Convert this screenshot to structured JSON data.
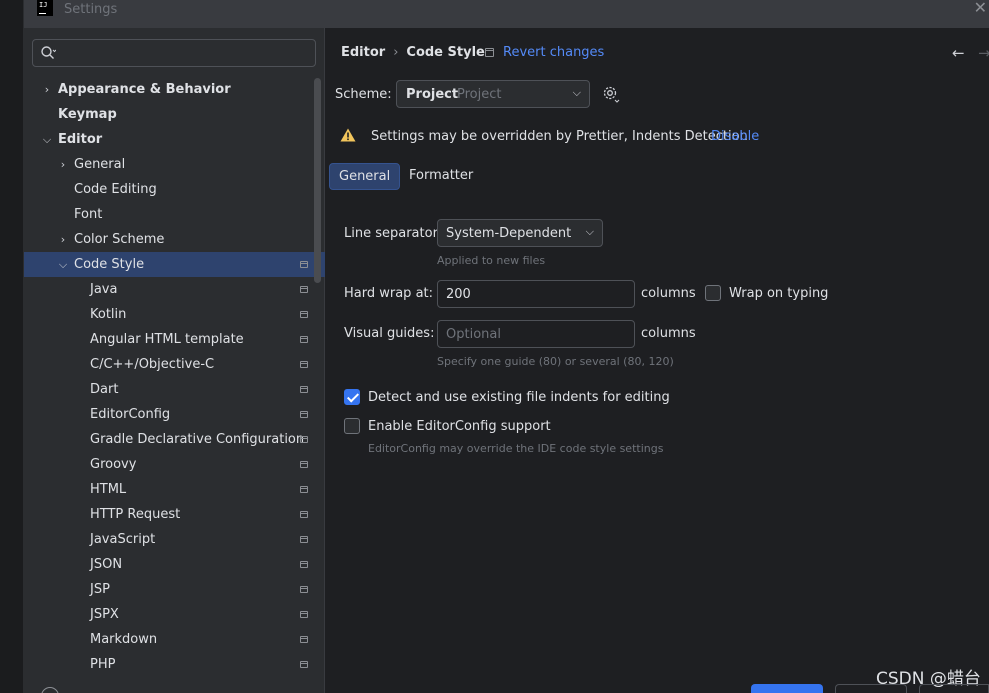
{
  "window": {
    "title": "Settings",
    "app_icon_text": "IJ"
  },
  "search": {
    "placeholder": ""
  },
  "tree": [
    {
      "label": "Appearance & Behavior",
      "bold": true,
      "chevron": "right",
      "depth": 0,
      "page_icon": false,
      "selected": false
    },
    {
      "label": "Keymap",
      "bold": true,
      "chevron": "",
      "depth": 0,
      "page_icon": false,
      "selected": false
    },
    {
      "label": "Editor",
      "bold": true,
      "chevron": "down",
      "depth": 0,
      "page_icon": false,
      "selected": false
    },
    {
      "label": "General",
      "bold": false,
      "chevron": "right",
      "depth": 1,
      "page_icon": false,
      "selected": false
    },
    {
      "label": "Code Editing",
      "bold": false,
      "chevron": "",
      "depth": 1,
      "page_icon": false,
      "selected": false
    },
    {
      "label": "Font",
      "bold": false,
      "chevron": "",
      "depth": 1,
      "page_icon": false,
      "selected": false
    },
    {
      "label": "Color Scheme",
      "bold": false,
      "chevron": "right",
      "depth": 1,
      "page_icon": false,
      "selected": false
    },
    {
      "label": "Code Style",
      "bold": false,
      "chevron": "down",
      "depth": 1,
      "page_icon": true,
      "selected": true
    },
    {
      "label": "Java",
      "bold": false,
      "chevron": "",
      "depth": 2,
      "page_icon": true,
      "selected": false
    },
    {
      "label": "Kotlin",
      "bold": false,
      "chevron": "",
      "depth": 2,
      "page_icon": true,
      "selected": false
    },
    {
      "label": "Angular HTML template",
      "bold": false,
      "chevron": "",
      "depth": 2,
      "page_icon": true,
      "selected": false
    },
    {
      "label": "C/C++/Objective-C",
      "bold": false,
      "chevron": "",
      "depth": 2,
      "page_icon": true,
      "selected": false
    },
    {
      "label": "Dart",
      "bold": false,
      "chevron": "",
      "depth": 2,
      "page_icon": true,
      "selected": false
    },
    {
      "label": "EditorConfig",
      "bold": false,
      "chevron": "",
      "depth": 2,
      "page_icon": true,
      "selected": false
    },
    {
      "label": "Gradle Declarative Configuration",
      "bold": false,
      "chevron": "",
      "depth": 2,
      "page_icon": true,
      "selected": false
    },
    {
      "label": "Groovy",
      "bold": false,
      "chevron": "",
      "depth": 2,
      "page_icon": true,
      "selected": false
    },
    {
      "label": "HTML",
      "bold": false,
      "chevron": "",
      "depth": 2,
      "page_icon": true,
      "selected": false
    },
    {
      "label": "HTTP Request",
      "bold": false,
      "chevron": "",
      "depth": 2,
      "page_icon": true,
      "selected": false
    },
    {
      "label": "JavaScript",
      "bold": false,
      "chevron": "",
      "depth": 2,
      "page_icon": true,
      "selected": false
    },
    {
      "label": "JSON",
      "bold": false,
      "chevron": "",
      "depth": 2,
      "page_icon": true,
      "selected": false
    },
    {
      "label": "JSP",
      "bold": false,
      "chevron": "",
      "depth": 2,
      "page_icon": true,
      "selected": false
    },
    {
      "label": "JSPX",
      "bold": false,
      "chevron": "",
      "depth": 2,
      "page_icon": true,
      "selected": false
    },
    {
      "label": "Markdown",
      "bold": false,
      "chevron": "",
      "depth": 2,
      "page_icon": true,
      "selected": false
    },
    {
      "label": "PHP",
      "bold": false,
      "chevron": "",
      "depth": 2,
      "page_icon": true,
      "selected": false
    }
  ],
  "header": {
    "breadcrumb_parent": "Editor",
    "breadcrumb_sep": "›",
    "breadcrumb_current": "Code Style",
    "revert_label": "Revert changes",
    "back_arrow": "←",
    "forward_arrow": "→"
  },
  "scheme": {
    "label": "Scheme:",
    "value": "Project",
    "sub": "Project"
  },
  "warning": {
    "text": "Settings may be overridden by Prettier, Indents Detection",
    "link": "Disable"
  },
  "tabs": [
    {
      "label": "General",
      "active": true
    },
    {
      "label": "Formatter",
      "active": false
    }
  ],
  "form": {
    "line_separator_label": "Line separator:",
    "line_separator_value": "System-Dependent",
    "line_separator_hint": "Applied to new files",
    "hard_wrap_label": "Hard wrap at:",
    "hard_wrap_value": "200",
    "hard_wrap_unit": "columns",
    "wrap_on_typing_label": "Wrap on typing",
    "wrap_on_typing_checked": false,
    "visual_guides_label": "Visual guides:",
    "visual_guides_placeholder": "Optional",
    "visual_guides_unit": "columns",
    "visual_guides_hint": "Specify one guide (80) or several (80, 120)",
    "detect_indents_label": "Detect and use existing file indents for editing",
    "detect_indents_checked": true,
    "editorconfig_label": "Enable EditorConfig support",
    "editorconfig_checked": false,
    "editorconfig_hint": "EditorConfig may override the IDE code style settings"
  },
  "watermark": "CSDN @蜡台",
  "colors": {
    "accent": "#3574f0",
    "link": "#548af7",
    "selection": "#2e436e",
    "warning": "#f2c55c"
  }
}
